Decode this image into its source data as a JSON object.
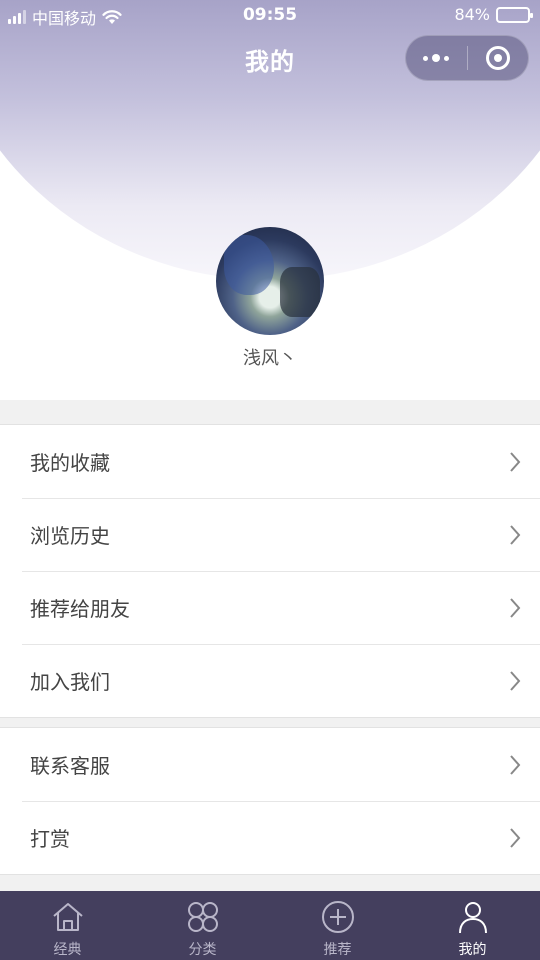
{
  "status_bar": {
    "carrier": "中国移动",
    "time": "09:55",
    "battery": "84%",
    "battery_level": 0.84
  },
  "nav": {
    "title": "我的",
    "capsule_icons": [
      "more-dots-icon",
      "mini-program-close-icon"
    ]
  },
  "profile": {
    "avatar_icon": "user-avatar-photo",
    "name": "浅风丶"
  },
  "menu_groups": [
    {
      "items": [
        {
          "label": "我的收藏",
          "icon": "chevron-right-icon"
        },
        {
          "label": "浏览历史",
          "icon": "chevron-right-icon"
        },
        {
          "label": "推荐给朋友",
          "icon": "chevron-right-icon"
        },
        {
          "label": "加入我们",
          "icon": "chevron-right-icon"
        }
      ]
    },
    {
      "items": [
        {
          "label": "联系客服",
          "icon": "chevron-right-icon"
        },
        {
          "label": "打赏",
          "icon": "chevron-right-icon"
        }
      ]
    }
  ],
  "tabbar": {
    "tabs": [
      {
        "label": "经典",
        "icon": "home-icon",
        "active": false
      },
      {
        "label": "分类",
        "icon": "category-grid-icon",
        "active": false
      },
      {
        "label": "推荐",
        "icon": "recommend-plus-icon",
        "active": false
      },
      {
        "label": "我的",
        "icon": "user-icon",
        "active": true
      }
    ]
  },
  "colors": {
    "header_top": "#7d78a8",
    "tabbar_bg": "#443f5e",
    "tab_inactive": "#b9b6c9",
    "tab_active": "#ffffff",
    "page_bg": "#f1f1f1"
  }
}
